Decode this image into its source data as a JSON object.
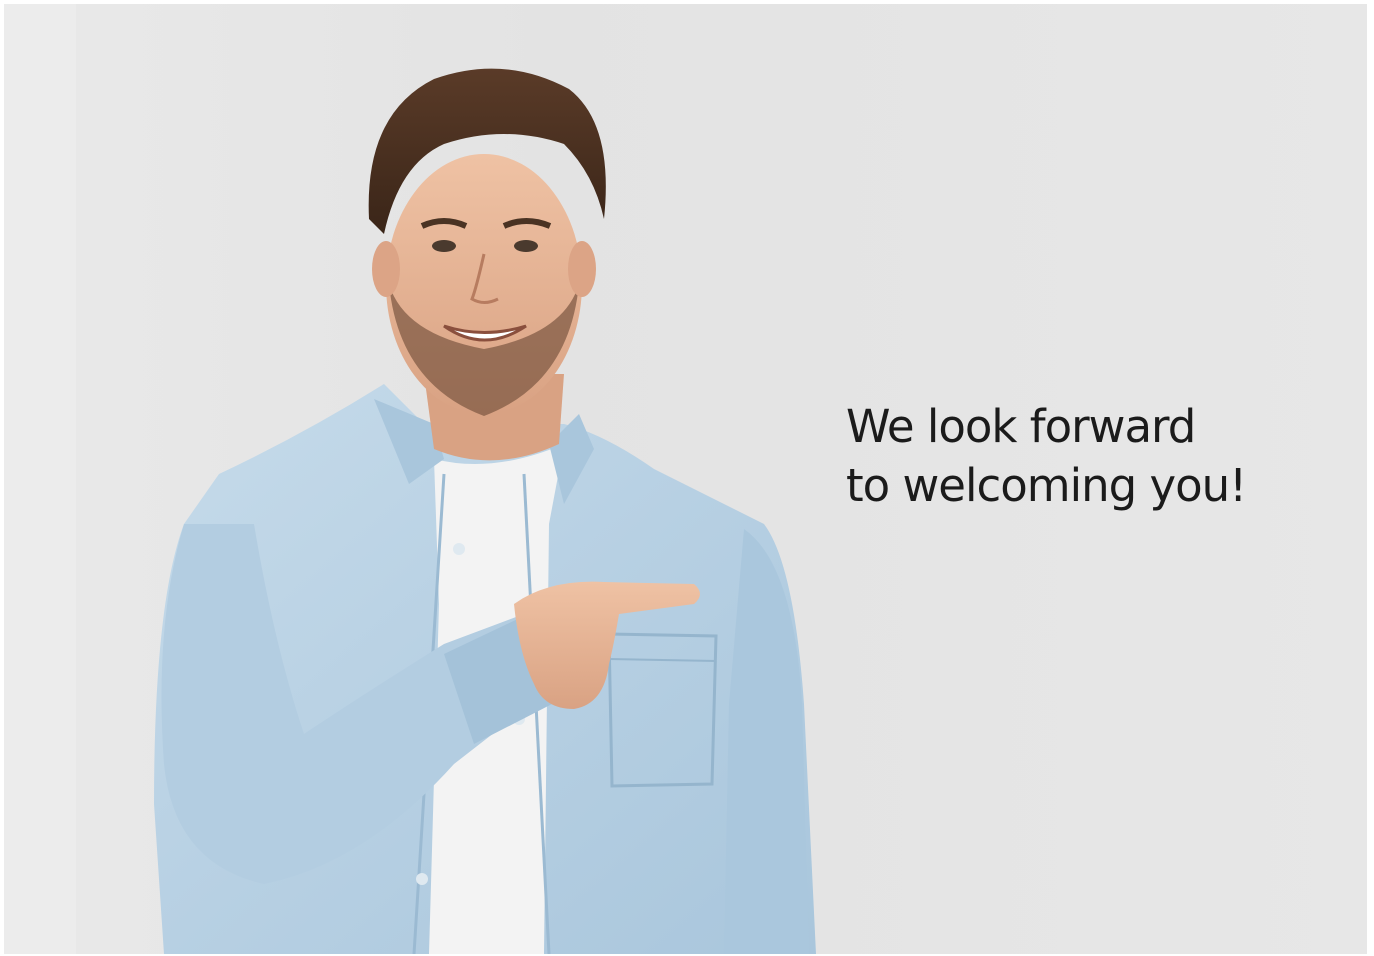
{
  "message": {
    "line1": "We look forward",
    "line2": "to welcoming you!"
  },
  "photo": {
    "icon": "person-pointing-image"
  },
  "colors": {
    "background": "#e6e6e6",
    "shirt": "#b9d3e6",
    "text": "#1b1b1b"
  }
}
